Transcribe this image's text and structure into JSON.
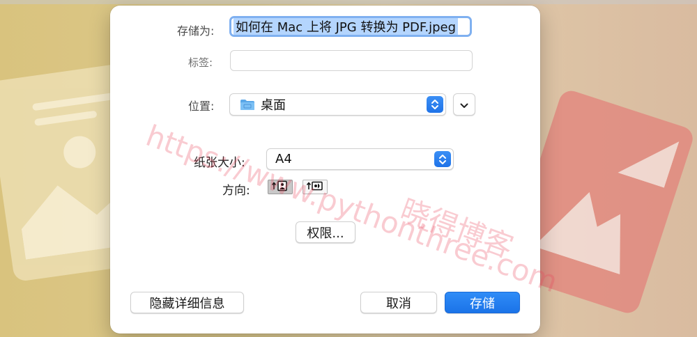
{
  "dialog": {
    "save_as_label": "存储为:",
    "filename": "如何在 Mac 上将 JPG 转换为 PDF.jpeg",
    "tags_label": "标签:",
    "tags_value": "",
    "location_label": "位置:",
    "location_value": "桌面",
    "location_icon": "folder-icon",
    "paper_size_label": "纸张大小:",
    "paper_size_value": "A4",
    "orientation_label": "方向:",
    "orientation_options": [
      "portrait",
      "landscape"
    ],
    "orientation_selected": "portrait",
    "permissions_button": "权限...",
    "hide_details_button": "隐藏详细信息",
    "cancel_button": "取消",
    "save_button": "存储"
  },
  "watermark": {
    "url": "https://www.pythonthree.com",
    "name": "晓得博客"
  },
  "colors": {
    "accent": "#1f73e8",
    "selection": "#b4d5fe",
    "focus_ring": "#7fb0f0"
  }
}
